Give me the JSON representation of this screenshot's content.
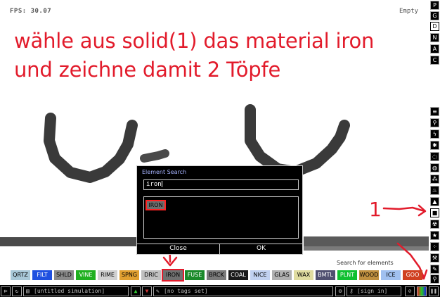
{
  "hud": {
    "fps": "FPS: 30.07",
    "empty": "Empty"
  },
  "instruction": {
    "line1": "wähle aus solid(1) das material iron",
    "line2": "und zeichne damit 2 Töpfe"
  },
  "right_column": {
    "letters": [
      "P",
      "G",
      "D",
      "N",
      "A",
      "C"
    ],
    "category_icons": [
      "menu-icon",
      "power-icon",
      "lightning-icon",
      "explosion-icon",
      "gas-icon",
      "liquid-icon",
      "powder-icon",
      "solid-icon",
      "radioactive-icon",
      "special-icon",
      "life-icon",
      "tools-icon",
      "favorite-icon",
      "search-icon"
    ]
  },
  "dialog": {
    "title": "Element Search",
    "query": "iron",
    "result": "IRON",
    "close_label": "Close",
    "ok_label": "OK"
  },
  "search_hint": "Search for elements",
  "annotation": {
    "number": "1"
  },
  "elements": [
    {
      "label": "QRTZ",
      "color": "#a8c8d8"
    },
    {
      "label": "FILT",
      "color": "#2050e0"
    },
    {
      "label": "SHLD",
      "color": "#8a8a8a"
    },
    {
      "label": "VINE",
      "color": "#20b020"
    },
    {
      "label": "RIME",
      "color": "#d0d0d0"
    },
    {
      "label": "SPNG",
      "color": "#e0a030"
    },
    {
      "label": "DRIC",
      "color": "#c0c0c0"
    },
    {
      "label": "IRON",
      "color": "#707070"
    },
    {
      "label": "FUSE",
      "color": "#1a8a2a"
    },
    {
      "label": "BRCK",
      "color": "#7a7a7a"
    },
    {
      "label": "COAL",
      "color": "#1a1a1a"
    },
    {
      "label": "NICE",
      "color": "#c0d0f0"
    },
    {
      "label": "GLAS",
      "color": "#b0b0b0"
    },
    {
      "label": "WAX",
      "color": "#e0dca0"
    },
    {
      "label": "BMTL",
      "color": "#505070"
    },
    {
      "label": "PLNT",
      "color": "#10c030"
    },
    {
      "label": "WOOD",
      "color": "#c09040"
    },
    {
      "label": "ICE",
      "color": "#a0c0f0"
    },
    {
      "label": "GOO",
      "color": "#d04020"
    }
  ],
  "bottom_bar": {
    "simulation_name": "[untitled simulation]",
    "tags": "[no tags set]",
    "sign_in": "[sign in]"
  },
  "colors": {
    "annotation_red": "#e21b2b",
    "dialog_title": "#a6b3ff",
    "stroke_gray": "#333333"
  }
}
